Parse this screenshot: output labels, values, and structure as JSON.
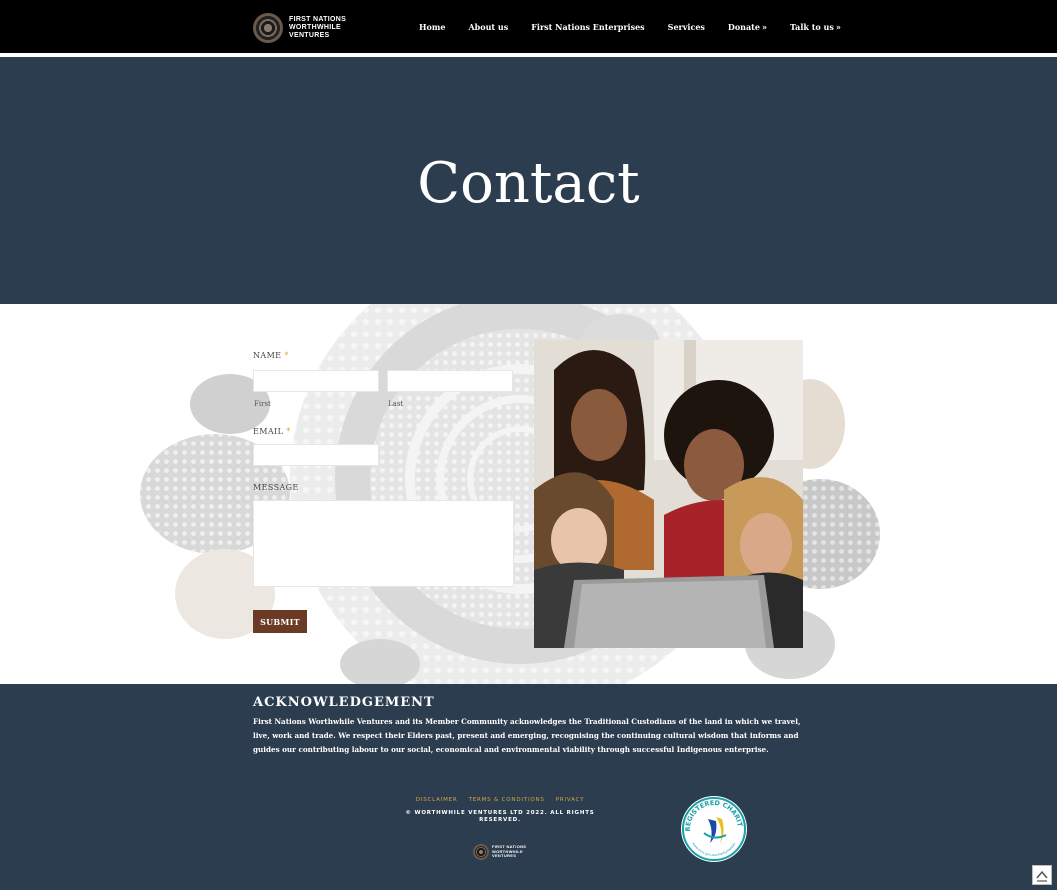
{
  "brand": {
    "line1": "FIRST NATIONS",
    "line2": "WORTHWHILE",
    "line3": "VENTURES"
  },
  "nav": {
    "items": [
      {
        "label": "Home",
        "dropdown": false
      },
      {
        "label": "About us",
        "dropdown": false
      },
      {
        "label": "First Nations Enterprises",
        "dropdown": false
      },
      {
        "label": "Services",
        "dropdown": false
      },
      {
        "label": "Donate",
        "dropdown": true
      },
      {
        "label": "Talk to us",
        "dropdown": true
      }
    ]
  },
  "hero": {
    "title": "Contact"
  },
  "form": {
    "name_label": "NAME",
    "email_label": "EMAIL",
    "message_label": "MESSAGE",
    "required_mark": "*",
    "first_sublabel": "First",
    "last_sublabel": "Last",
    "first_value": "",
    "last_value": "",
    "email_value": "",
    "message_value": "",
    "submit_label": "SUBMIT"
  },
  "footer": {
    "ack_title": "ACKNOWLEDGEMENT",
    "ack_text": "First Nations Worthwhile Ventures and its Member Community acknowledges the Traditional Custodians of the land in which we travel, live, work and trade. We respect their Elders past, present and emerging, recognising the continuing cultural wisdom that informs and guides our contributing labour to our social, economical and environmental viability through successful Indigenous enterprise.",
    "links": [
      "DISCLAIMER",
      "TERMS & CONDITIONS",
      "PRIVACY"
    ],
    "copyright": "© WORTHWHILE VENTURES LTD 2022. ALL RIGHTS RESERVED.",
    "charity_badge_top": "REGISTERED CHARITY",
    "charity_badge_bottom": "www.acnc.gov.au/charityregister"
  },
  "colors": {
    "navy": "#2c3d4f",
    "submit": "#6b3a24",
    "required": "#e0a020",
    "link_gold": "#d9a441"
  }
}
